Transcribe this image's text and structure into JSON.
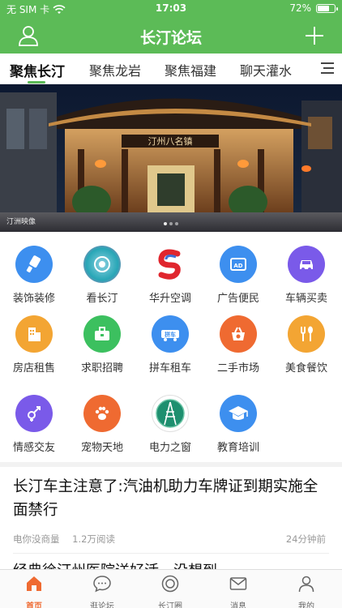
{
  "status_bar": {
    "carrier": "无 SIM 卡",
    "time": "17:03",
    "battery_percent": "72%",
    "battery_level": 0.72
  },
  "header": {
    "title": "长汀论坛"
  },
  "tabs": [
    {
      "label": "聚焦长汀",
      "active": true
    },
    {
      "label": "聚焦龙岩"
    },
    {
      "label": "聚焦福建"
    },
    {
      "label": "聊天灌水"
    }
  ],
  "banner": {
    "signboard": "汀州八名镇",
    "watermark": "汀洲映像"
  },
  "categories": [
    {
      "label": "装饰装修",
      "icon": "paint-brush-icon",
      "color": "#3d8fef"
    },
    {
      "label": "看长汀",
      "icon": "camera-lens-icon",
      "color": "#27a6b6"
    },
    {
      "label": "华升空调",
      "icon": "brand-logo-icon",
      "color": "#e0262e"
    },
    {
      "label": "广告便民",
      "icon": "ad-board-icon",
      "color": "#3d8fef"
    },
    {
      "label": "车辆买卖",
      "icon": "car-icon",
      "color": "#7a5ae9"
    },
    {
      "label": "房店租售",
      "icon": "building-icon",
      "color": "#f3a533"
    },
    {
      "label": "求职招聘",
      "icon": "briefcase-icon",
      "color": "#3cc05f"
    },
    {
      "label": "拼车租车",
      "icon": "carpool-icon",
      "color": "#3d8fef"
    },
    {
      "label": "二手市场",
      "icon": "basket-icon",
      "color": "#ef6a31"
    },
    {
      "label": "美食餐饮",
      "icon": "fork-spoon-icon",
      "color": "#f3a533"
    },
    {
      "label": "情感交友",
      "icon": "gender-icon",
      "color": "#7a5ae9"
    },
    {
      "label": "宠物天地",
      "icon": "paw-icon",
      "color": "#ef6a31"
    },
    {
      "label": "电力之窗",
      "icon": "power-grid-logo-icon",
      "color": "#1e8f6f"
    },
    {
      "label": "教育培训",
      "icon": "graduation-cap-icon",
      "color": "#3d8fef"
    }
  ],
  "pinche_badge": "拼车",
  "posts": [
    {
      "title": "长汀车主注意了:汽油机助力车牌证到期实施全面禁行",
      "author": "电你没商量",
      "reads": "1.2万阅读",
      "time": "24分钟前"
    },
    {
      "title": "经典徐汀州医院送好活，没想到"
    }
  ],
  "bottom_nav": [
    {
      "label": "首页",
      "icon": "home-icon",
      "active": true
    },
    {
      "label": "逛论坛",
      "icon": "chat-bubble-icon"
    },
    {
      "label": "长汀圈",
      "icon": "circle-icon"
    },
    {
      "label": "消息",
      "icon": "mail-icon"
    },
    {
      "label": "我的",
      "icon": "person-icon"
    }
  ],
  "colors": {
    "brand": "#5cbb57",
    "active_nav": "#ef6a31"
  }
}
